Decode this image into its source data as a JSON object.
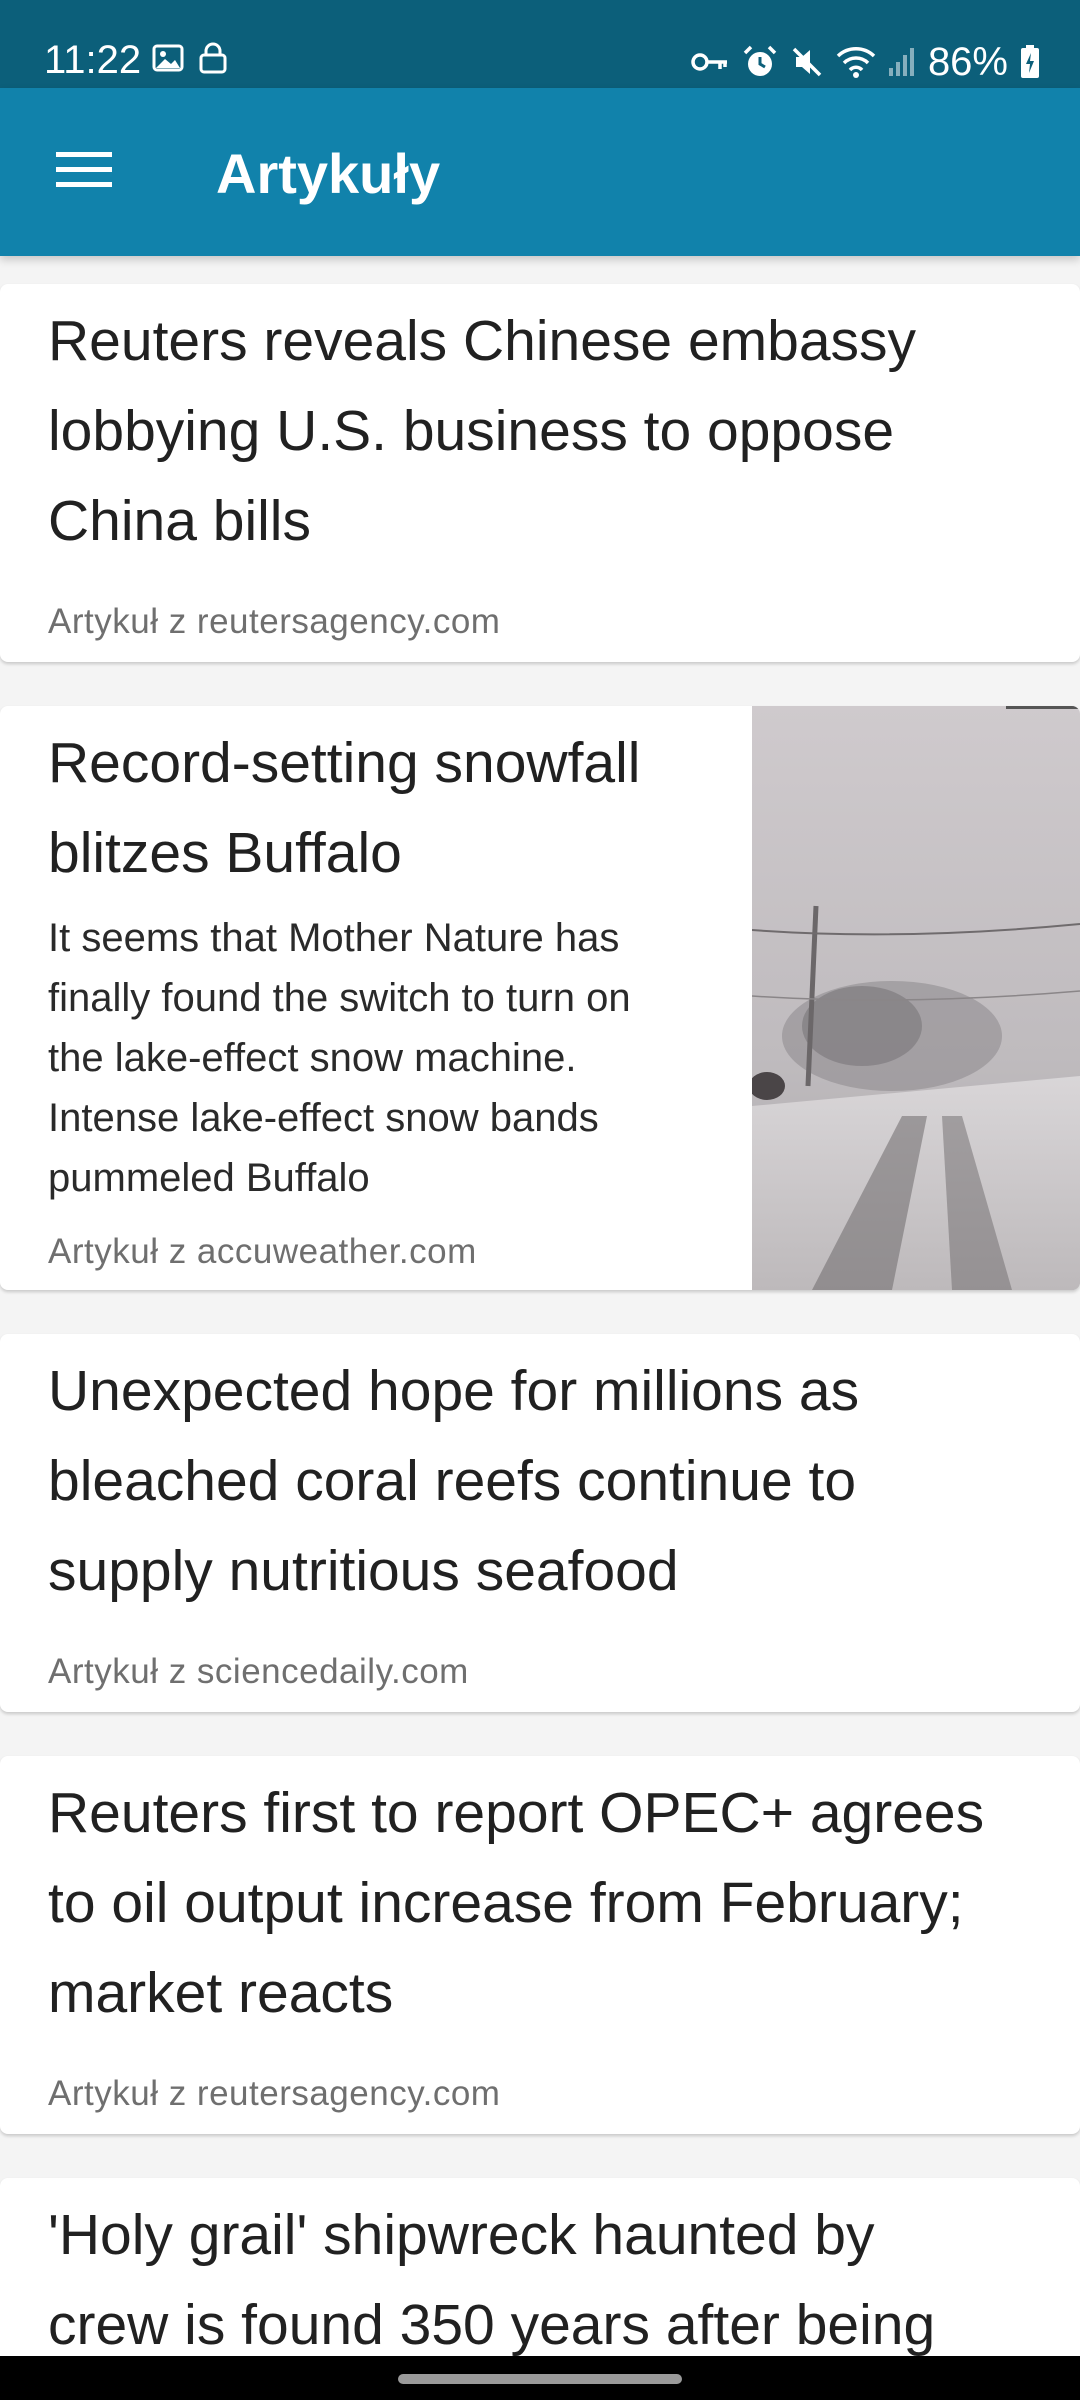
{
  "status_bar": {
    "time": "11:22",
    "battery_percent": "86%",
    "icons": [
      "image-icon",
      "lock-icon",
      "vpn-key-icon",
      "alarm-icon",
      "mute-icon",
      "wifi-icon",
      "signal-icon",
      "battery-charging-icon"
    ]
  },
  "app_bar": {
    "title": "Artykuły",
    "menu_icon": "hamburger-menu-icon"
  },
  "articles": [
    {
      "title": "Reuters reveals Chinese embassy lobbying U.S. business to oppose China bills",
      "source": "Artykuł z reutersagency.com"
    },
    {
      "title": "Record-setting snowfall blitzes Buffalo",
      "snippet": "It seems that Mother Nature has finally found the switch to turn on the lake-effect snow machine. Intense lake-effect snow bands pummeled Buffalo",
      "source": "Artykuł z accuweather.com"
    },
    {
      "title": "Unexpected hope for millions as bleached coral reefs continue to supply nutritious seafood",
      "source": "Artykuł z sciencedaily.com"
    },
    {
      "title": "Reuters first to report OPEC+ agrees to oil output increase from February; market reacts",
      "source": "Artykuł z reutersagency.com"
    },
    {
      "title": "'Holy grail' shipwreck haunted by crew is found 350 years after being"
    }
  ],
  "colors": {
    "status_bar": "#0c5f7a",
    "app_bar": "#1182ab",
    "background": "#f4f4f4",
    "card": "#ffffff"
  }
}
